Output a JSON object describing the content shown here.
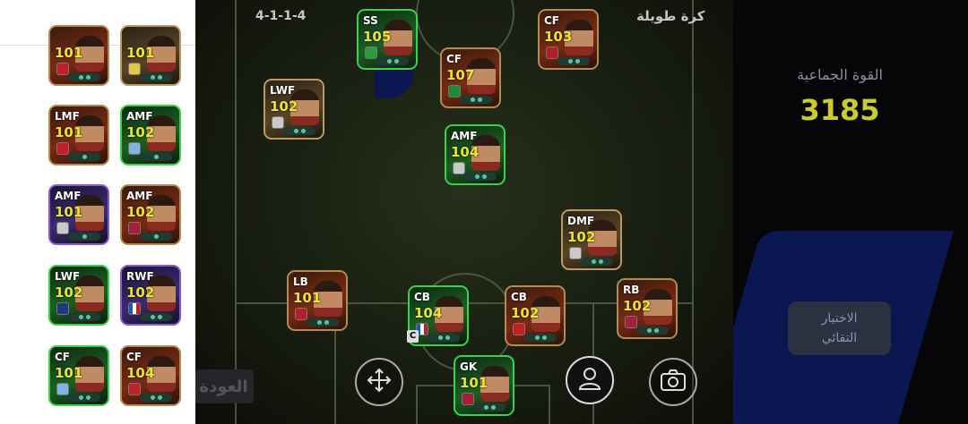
{
  "field": {
    "formation": "4-1-1-4",
    "play_style": "كرة طويلة"
  },
  "team": {
    "strength_label": "القوة الجماعية",
    "strength_value": "3185"
  },
  "controls": {
    "auto_select": "الاختيار\nالتقائي",
    "back": "العودة"
  },
  "captain_marker": "C",
  "lineup": [
    {
      "pos": "SS",
      "rating": "105",
      "color": "green"
    },
    {
      "pos": "CF",
      "rating": "103",
      "color": "brown"
    },
    {
      "pos": "CF",
      "rating": "107",
      "color": "brown"
    },
    {
      "pos": "LWF",
      "rating": "102",
      "color": "field"
    },
    {
      "pos": "AMF",
      "rating": "104",
      "color": "green"
    },
    {
      "pos": "DMF",
      "rating": "102",
      "color": "field"
    },
    {
      "pos": "LB",
      "rating": "101",
      "color": "brown"
    },
    {
      "pos": "CB",
      "rating": "104",
      "color": "green"
    },
    {
      "pos": "CB",
      "rating": "102",
      "color": "brown"
    },
    {
      "pos": "RB",
      "rating": "102",
      "color": "brown"
    },
    {
      "pos": "GK",
      "rating": "101",
      "color": "green"
    }
  ],
  "reserves": [
    {
      "pos": "",
      "rating": "101",
      "color": "brown"
    },
    {
      "pos": "",
      "rating": "101",
      "color": "field"
    },
    {
      "pos": "LMF",
      "rating": "101",
      "color": "brown"
    },
    {
      "pos": "AMF",
      "rating": "102",
      "color": "green"
    },
    {
      "pos": "AMF",
      "rating": "101",
      "color": "purple"
    },
    {
      "pos": "AMF",
      "rating": "102",
      "color": "brown"
    },
    {
      "pos": "LWF",
      "rating": "102",
      "color": "green"
    },
    {
      "pos": "RWF",
      "rating": "102",
      "color": "purple"
    },
    {
      "pos": "CF",
      "rating": "101",
      "color": "green"
    },
    {
      "pos": "CF",
      "rating": "104",
      "color": "brown"
    }
  ],
  "icons": {
    "move": "move-arrows-icon",
    "person": "person-icon",
    "camera": "camera-icon"
  }
}
